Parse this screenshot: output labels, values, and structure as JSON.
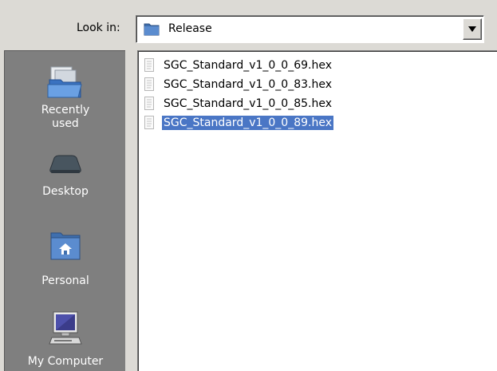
{
  "lookin": {
    "label": "Look in:",
    "value": "Release",
    "folder_icon": "folder-icon",
    "dropdown_icon": "dropdown-arrow-icon"
  },
  "sidebar": {
    "items": [
      {
        "label": "Recently used",
        "icon": "recent-documents-icon"
      },
      {
        "label": "Desktop",
        "icon": "desktop-icon"
      },
      {
        "label": "Personal",
        "icon": "home-folder-icon"
      },
      {
        "label": "My Computer",
        "icon": "computer-icon"
      }
    ]
  },
  "files": [
    {
      "name": "SGC_Standard_v1_0_0_69.hex",
      "selected": false
    },
    {
      "name": "SGC_Standard_v1_0_0_83.hex",
      "selected": false
    },
    {
      "name": "SGC_Standard_v1_0_0_85.hex",
      "selected": false
    },
    {
      "name": "SGC_Standard_v1_0_0_89.hex",
      "selected": true
    }
  ],
  "colors": {
    "background": "#dcdad5",
    "sidebar": "#7f7f7f",
    "selection": "#4a76c5",
    "folder": "#4a78b8"
  }
}
